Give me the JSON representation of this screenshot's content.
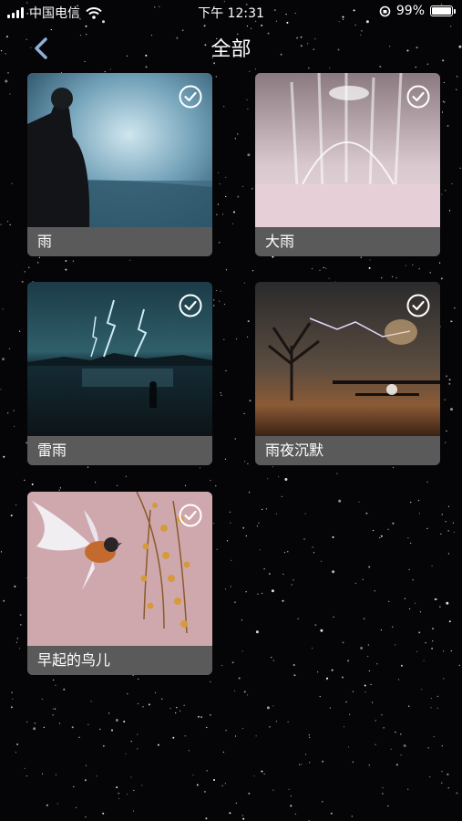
{
  "status": {
    "carrier": "中国电信",
    "time": "下午 12:31",
    "battery": "99%",
    "battery_level": 0.99
  },
  "nav": {
    "title": "全部"
  },
  "cards": [
    {
      "label": "雨",
      "selected": true
    },
    {
      "label": "大雨",
      "selected": true
    },
    {
      "label": "雷雨",
      "selected": true
    },
    {
      "label": "雨夜沉默",
      "selected": true
    },
    {
      "label": "早起的鸟儿",
      "selected": true
    }
  ]
}
